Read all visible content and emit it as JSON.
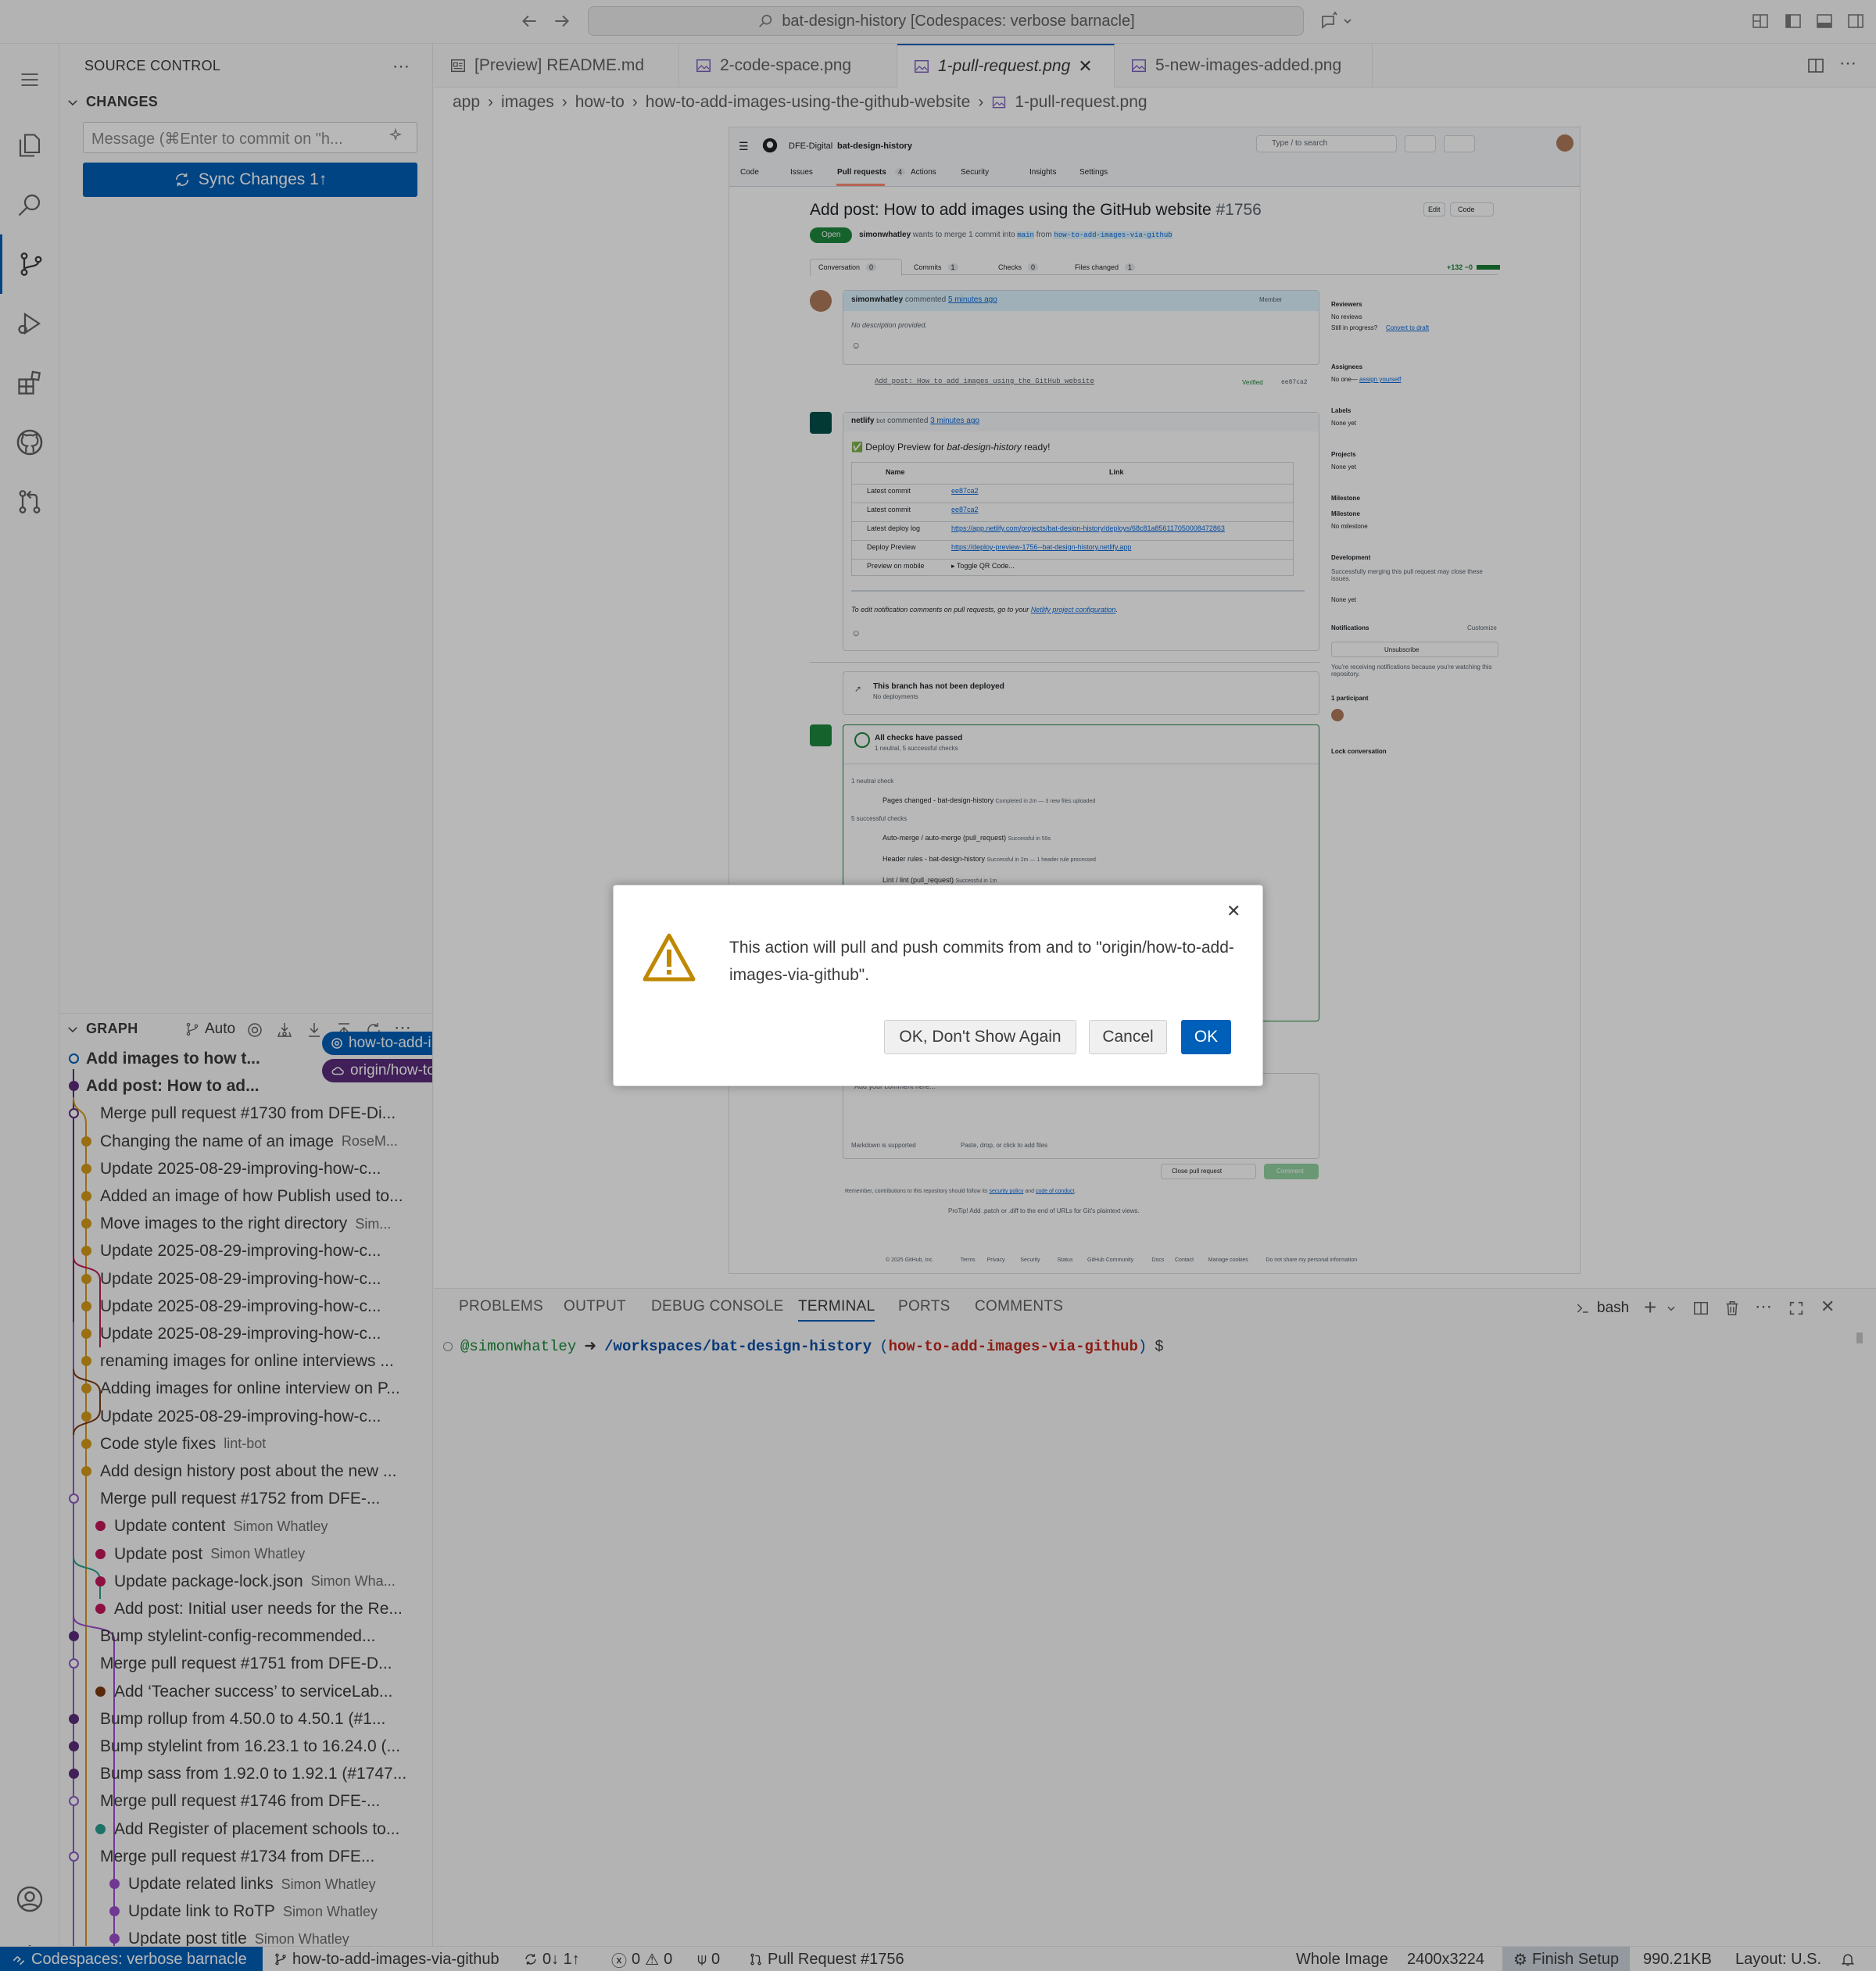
{
  "titlebar": {
    "search_text": "bat-design-history [Codespaces: verbose barnacle]"
  },
  "activity_bar": {
    "items": [
      "menu-icon",
      "explorer-icon",
      "search-icon",
      "source-control-icon",
      "run-debug-icon",
      "extensions-icon",
      "github-icon",
      "pull-requests-icon"
    ],
    "bottom": [
      "account-icon",
      "settings-gear-icon"
    ]
  },
  "sidebar": {
    "title": "SOURCE CONTROL",
    "changes_label": "CHANGES",
    "commit_placeholder": "Message (⌘Enter to commit on \"h...",
    "sync_label": "Sync Changes 1↑",
    "graph_label": "GRAPH",
    "graph_auto": "Auto",
    "graph_rows": [
      {
        "msg": "Add images to how t...",
        "author": "",
        "pill": "how-to-add-im..."
      },
      {
        "msg": "Add post: How to ad...",
        "author": "",
        "pill": "origin/how-to-a..."
      },
      {
        "msg": "Merge pull request #1730 from DFE-Di...",
        "author": ""
      },
      {
        "msg": "Changing the name of an image",
        "author": "RoseM..."
      },
      {
        "msg": "Update 2025-08-29-improving-how-c...",
        "author": ""
      },
      {
        "msg": "Added an image of how Publish used to...",
        "author": ""
      },
      {
        "msg": "Move images to the right directory",
        "author": "Sim..."
      },
      {
        "msg": "Update 2025-08-29-improving-how-c...",
        "author": ""
      },
      {
        "msg": "Update 2025-08-29-improving-how-c...",
        "author": ""
      },
      {
        "msg": "Update 2025-08-29-improving-how-c...",
        "author": ""
      },
      {
        "msg": "Update 2025-08-29-improving-how-c...",
        "author": ""
      },
      {
        "msg": "renaming images for online interviews ...",
        "author": ""
      },
      {
        "msg": "Adding images for online interview on P...",
        "author": ""
      },
      {
        "msg": "Update 2025-08-29-improving-how-c...",
        "author": ""
      },
      {
        "msg": "Code style fixes",
        "author": "lint-bot"
      },
      {
        "msg": "Add design history post about the new ...",
        "author": ""
      },
      {
        "msg": "Merge pull request #1752 from DFE-...",
        "author": ""
      },
      {
        "msg": "Update content",
        "author": "Simon Whatley"
      },
      {
        "msg": "Update post",
        "author": "Simon Whatley"
      },
      {
        "msg": "Update package-lock.json",
        "author": "Simon Wha..."
      },
      {
        "msg": "Add post: Initial user needs for the Re...",
        "author": ""
      },
      {
        "msg": "Bump stylelint-config-recommended...",
        "author": ""
      },
      {
        "msg": "Merge pull request #1751 from DFE-D...",
        "author": ""
      },
      {
        "msg": "Add ‘Teacher success’ to serviceLab...",
        "author": ""
      },
      {
        "msg": "Bump rollup from 4.50.0 to 4.50.1 (#1...",
        "author": ""
      },
      {
        "msg": "Bump stylelint from 16.23.1 to 16.24.0 (...",
        "author": ""
      },
      {
        "msg": "Bump sass from 1.92.0 to 1.92.1 (#1747...",
        "author": ""
      },
      {
        "msg": "Merge pull request #1746 from DFE-...",
        "author": ""
      },
      {
        "msg": "Add Register of placement schools to...",
        "author": ""
      },
      {
        "msg": "Merge pull request #1734 from DFE...",
        "author": ""
      },
      {
        "msg": "Update related links",
        "author": "Simon Whatley"
      },
      {
        "msg": "Update link to RoTP",
        "author": "Simon Whatley"
      },
      {
        "msg": "Update post title",
        "author": "Simon Whatley"
      }
    ]
  },
  "editor": {
    "tabs": [
      "[Preview] README.md",
      "2-code-space.png",
      "1-pull-request.png",
      "5-new-images-added.png"
    ],
    "breadcrumb": [
      "app",
      "images",
      "how-to",
      "how-to-add-images-using-the-github-website",
      "1-pull-request.png"
    ]
  },
  "github": {
    "org": "DFE-Digital",
    "repo": "bat-design-history",
    "search": "Type / to search",
    "nav": [
      "Code",
      "Issues",
      "Pull requests",
      "Actions",
      "Security",
      "Insights",
      "Settings"
    ],
    "pr_count": "4",
    "pr_title": "Add post: How to add images using the GitHub website",
    "pr_number": "#1756",
    "edit": "Edit",
    "code_btn": "Code",
    "state": "Open",
    "meta_user": "simonwhatley",
    "meta_text": "wants to merge 1 commit into",
    "base_branch": "main",
    "from": "from",
    "head_branch": "how-to-add-images-via-github",
    "subtabs": [
      "Conversation",
      "Commits",
      "Checks",
      "Files changed"
    ],
    "subtab_counts": [
      "0",
      "1",
      "0",
      "1"
    ],
    "diffstat": "+132 −0",
    "comment_user": "simonwhatley",
    "commented": "commented",
    "comment_time": "5 minutes ago",
    "member": "Member",
    "no_desc": "No description provided.",
    "commit_msg": "Add post: How to add images using the GitHub website",
    "verified": "Verified",
    "commit_sha": "ee87ca2",
    "bot_user": "netlify",
    "bot": "bot",
    "bot_time": "3 minutes ago",
    "deploy_heading_pre": "Deploy Preview for",
    "deploy_heading_repo": "bat-design-history",
    "deploy_heading_post": "ready!",
    "table_headers": [
      "Name",
      "Link"
    ],
    "table_rows": [
      [
        "Latest commit",
        "ee87ca2"
      ],
      [
        "Latest commit",
        "ee87ca2"
      ],
      [
        "Latest deploy log",
        "https://app.netlify.com/projects/bat-design-history/deploys/68c81a856117050008472863"
      ],
      [
        "Deploy Preview",
        "https://deploy-preview-1756--bat-design-history.netlify.app"
      ],
      [
        "Preview on mobile",
        "▸ Toggle QR Code..."
      ]
    ],
    "notif_text": "To edit notification comments on pull requests, go to your",
    "notif_link": "Netlify project configuration",
    "not_deployed": "This branch has not been deployed",
    "no_deployments": "No deployments",
    "checks_title": "All checks have passed",
    "checks_sub": "1 neutral, 5 successful checks",
    "neutral_check": "1 neutral check",
    "check1": "Pages changed - bat-design-history",
    "check1_status": "Completed in 2m — 3 new files uploaded",
    "successful_checks": "5 successful checks",
    "check2": "Auto-merge / auto-merge (pull_request)",
    "check2_status": "Successful in 59s",
    "check3": "Header rules - bat-design-history",
    "check3_status": "Successful in 2m — 1 header rule processed",
    "check4": "Lint / lint (pull_request)",
    "check4_status": "Successful in 1m",
    "add_comment": "Add your comment here...",
    "markdown": "Markdown is supported",
    "paste": "Paste, drop, or click to add files",
    "close_pr": "Close pull request",
    "comment_btn": "Comment",
    "remember": "Remember, contributions to this repository should follow its",
    "security_policy": "security policy",
    "and": "and",
    "code_of_conduct": "code of conduct",
    "protip": "ProTip! Add .patch or .diff to the end of URLs for Git's plaintext views.",
    "footer": [
      "© 2025 GitHub, Inc.",
      "Terms",
      "Privacy",
      "Security",
      "Status",
      "GitHub Community",
      "Docs",
      "Contact",
      "Manage cookies",
      "Do not share my personal information"
    ],
    "side": {
      "reviewers": "Reviewers",
      "no_reviews": "No reviews",
      "still": "Still in progress?",
      "convert": "Convert to draft",
      "assignees": "Assignees",
      "no_one": "No one—",
      "assign_yourself": "assign yourself",
      "labels": "Labels",
      "none_yet": "None yet",
      "projects": "Projects",
      "milestone": "Milestone",
      "no_milestone": "No milestone",
      "development": "Development",
      "dev_text": "Successfully merging this pull request may close these issues.",
      "notifications": "Notifications",
      "customize": "Customize",
      "unsubscribe": "Unsubscribe",
      "notif_reason": "You're receiving notifications because you're watching this repository.",
      "participants": "1 participant",
      "lock": "Lock conversation"
    }
  },
  "panel": {
    "tabs": [
      "PROBLEMS",
      "OUTPUT",
      "DEBUG CONSOLE",
      "TERMINAL",
      "PORTS",
      "COMMENTS"
    ],
    "shell": "bash",
    "prompt_user": "@simonwhatley",
    "prompt_arrow": "➜",
    "prompt_path": "/workspaces/bat-design-history",
    "prompt_branch_open": "(",
    "prompt_branch": "how-to-add-images-via-github",
    "prompt_branch_close": ")",
    "prompt_dollar": "$"
  },
  "statusbar": {
    "remote": "Codespaces: verbose barnacle",
    "branch": "how-to-add-images-via-github",
    "sync": "0↓ 1↑",
    "problems": "0",
    "warnings": "0",
    "ports": "0",
    "pr": "Pull Request #1756",
    "image_mode": "Whole Image",
    "dimensions": "2400x3224",
    "finish_setup": "Finish Setup",
    "size": "990.21KB",
    "layout": "Layout: U.S."
  },
  "dialog": {
    "message": "This action will pull and push commits from and to \"origin/how-to-add-images-via-github\".",
    "btn_dont_show": "OK, Don't Show Again",
    "btn_cancel": "Cancel",
    "btn_ok": "OK"
  },
  "colors": {
    "accent": "#005fb8",
    "warning": "#bf8803",
    "status_remote": "#005fb8"
  }
}
